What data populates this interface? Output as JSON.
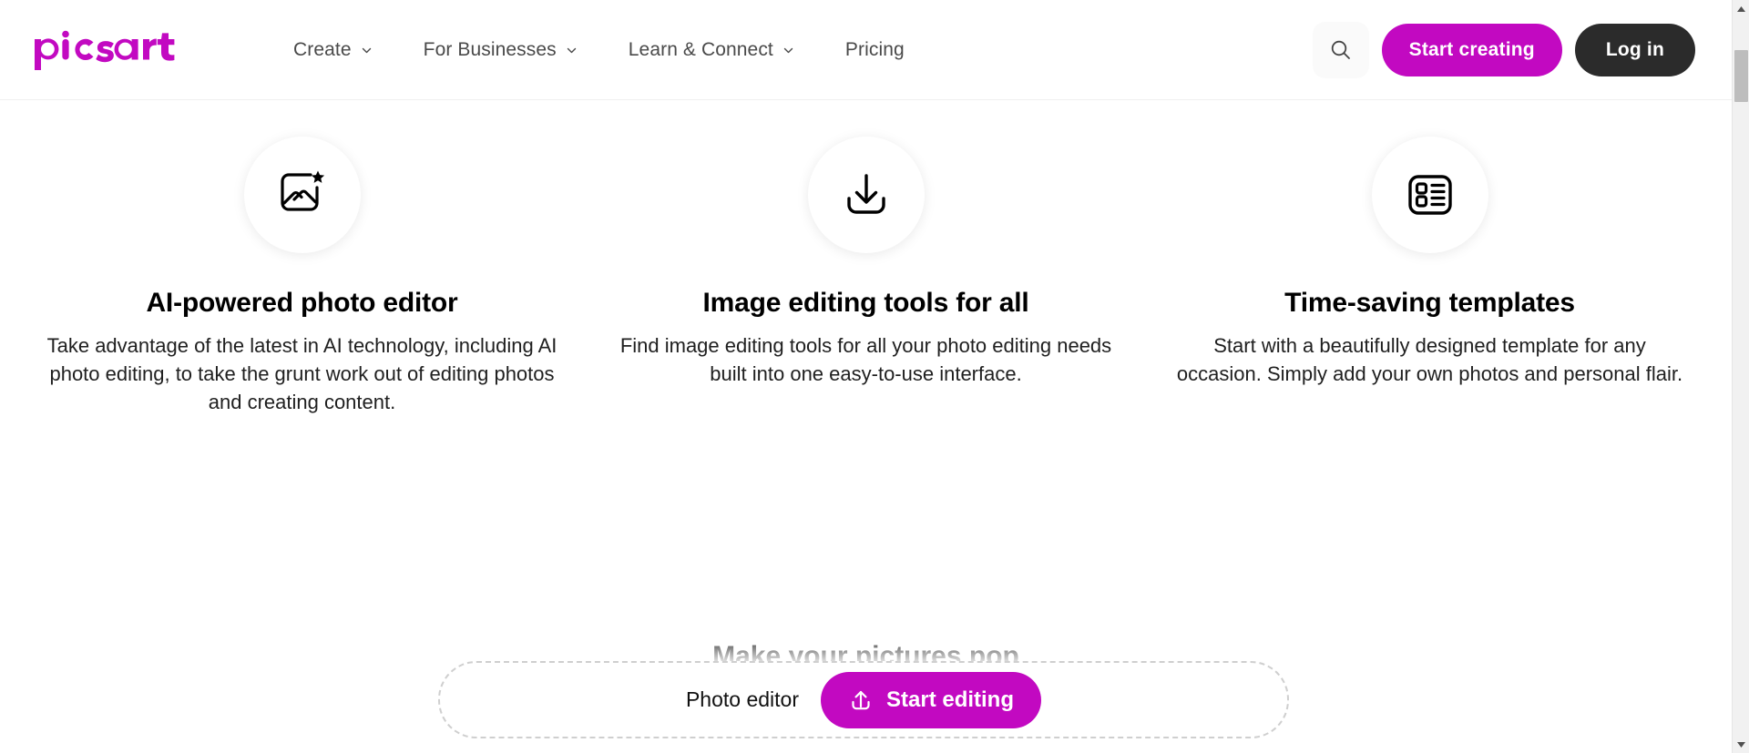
{
  "brand": {
    "name": "Picsart",
    "logo_color": "#c209c1"
  },
  "header": {
    "nav_items": [
      {
        "label": "Create",
        "has_chevron": true,
        "icon": "chevron-down-icon"
      },
      {
        "label": "For Businesses",
        "has_chevron": true,
        "icon": "chevron-down-icon"
      },
      {
        "label": "Learn & Connect",
        "has_chevron": true,
        "icon": "chevron-down-icon"
      },
      {
        "label": "Pricing",
        "has_chevron": false,
        "icon": ""
      }
    ],
    "search_icon": "search-icon",
    "start_creating_label": "Start creating",
    "login_label": "Log in",
    "accent_color": "#c209c1",
    "login_bg_color": "#2b2b2b"
  },
  "features": [
    {
      "icon": "image-sparkle-icon",
      "title": "AI-powered photo editor",
      "description": "Take advantage of the latest in AI technology, including AI photo editing, to take the grunt work out of editing photos and creating content."
    },
    {
      "icon": "download-icon",
      "title": "Image editing tools for all",
      "description": "Find image editing tools for all your photo editing needs built into one easy-to-use interface."
    },
    {
      "icon": "templates-list-icon",
      "title": "Time-saving templates",
      "description": "Start with a beautifully designed template for any occasion. Simply add your own photos and personal flair."
    }
  ],
  "clipped_headline": "Make your pictures pop",
  "upload_bar": {
    "label": "Photo editor",
    "button_label": "Start editing",
    "button_icon": "upload-icon",
    "button_color": "#c209c1"
  },
  "scrollbar": {
    "up_arrow_icon": "triangle-up-icon",
    "down_arrow_icon": "triangle-down-icon",
    "thumb": "scroll-thumb"
  }
}
